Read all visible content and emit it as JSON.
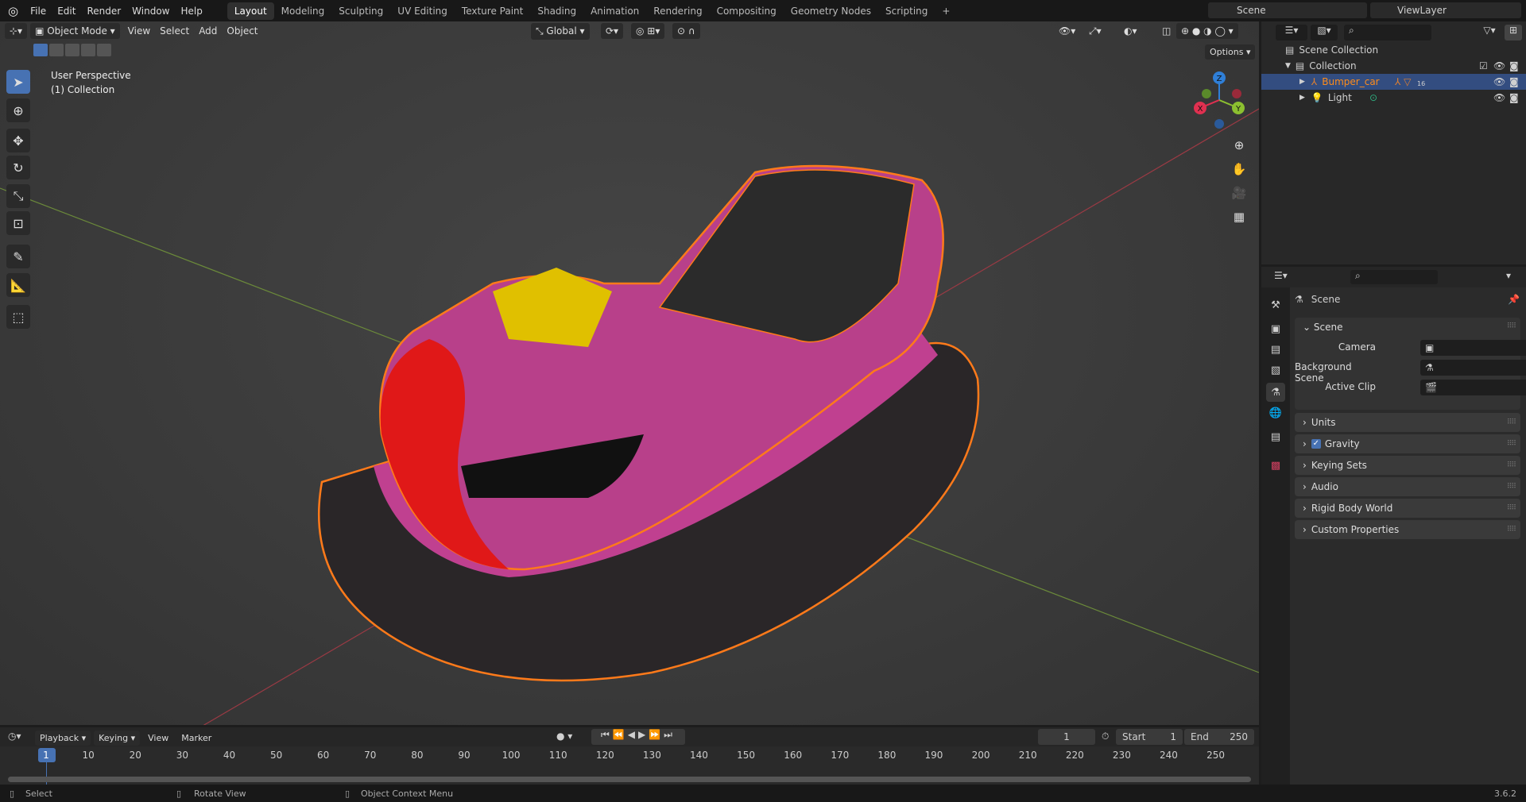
{
  "menu": [
    "File",
    "Edit",
    "Render",
    "Window",
    "Help"
  ],
  "workspaces": [
    "Layout",
    "Modeling",
    "Sculpting",
    "UV Editing",
    "Texture Paint",
    "Shading",
    "Animation",
    "Rendering",
    "Compositing",
    "Geometry Nodes",
    "Scripting",
    "+"
  ],
  "scene_name": "Scene",
  "view_layer": "ViewLayer",
  "viewport": {
    "mode": "Object Mode",
    "menus": [
      "View",
      "Select",
      "Add",
      "Object"
    ],
    "orientation": "Global",
    "options": "Options",
    "overlay_line1": "User Perspective",
    "overlay_line2": "(1) Collection",
    "gizmo": {
      "x": "X",
      "y": "Y",
      "z": "Z"
    }
  },
  "outliner": {
    "scene_collection": "Scene Collection",
    "collection": "Collection",
    "items": [
      {
        "name": "Bumper_car",
        "badge": "16"
      },
      {
        "name": "Light"
      }
    ]
  },
  "properties": {
    "title": "Scene",
    "section": "Scene",
    "fields": [
      {
        "label": "Camera"
      },
      {
        "label": "Background Scene"
      },
      {
        "label": "Active Clip"
      }
    ],
    "panels": [
      "Units",
      "Gravity",
      "Keying Sets",
      "Audio",
      "Rigid Body World",
      "Custom Properties"
    ],
    "gravity_checked": true
  },
  "timeline": {
    "menus": [
      "Playback",
      "Keying",
      "View",
      "Marker"
    ],
    "current_frame": "1",
    "start_label": "Start",
    "start": "1",
    "end_label": "End",
    "end": "250",
    "ticks": [
      "1",
      "10",
      "20",
      "30",
      "40",
      "50",
      "60",
      "70",
      "80",
      "90",
      "100",
      "110",
      "120",
      "130",
      "140",
      "150",
      "160",
      "170",
      "180",
      "190",
      "200",
      "210",
      "220",
      "230",
      "240",
      "250"
    ]
  },
  "status": {
    "select": "Select",
    "rotate": "Rotate View",
    "context": "Object Context Menu",
    "version": "3.6.2"
  },
  "colors": {
    "accent": "#4772b3",
    "selection": "#ff7a1a",
    "selected_text": "#ff8c1a"
  }
}
